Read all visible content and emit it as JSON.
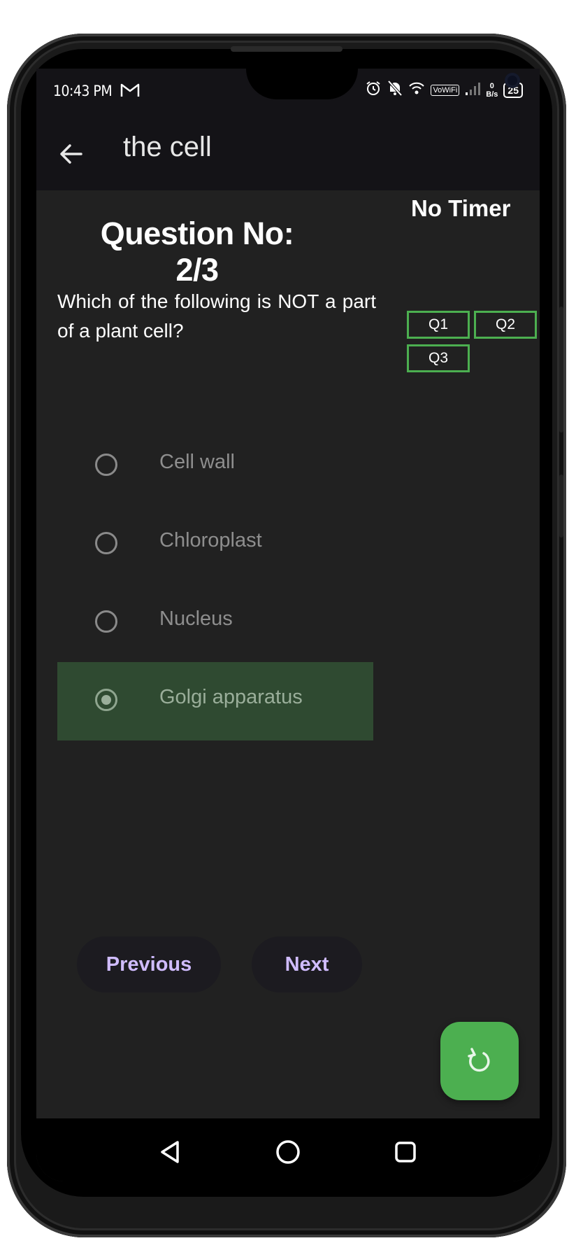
{
  "status_bar": {
    "time": "10:43 PM",
    "wifi_label": "VoWiFi",
    "speed_value": "0",
    "speed_unit": "B/s",
    "battery": "25"
  },
  "app_bar": {
    "title": "the cell"
  },
  "quiz": {
    "question_label": "Question No: 2/3",
    "question_text": "Which of the following is NOT a part of a plant cell?",
    "timer_label": "No Timer",
    "question_nav": [
      "Q1",
      "Q2",
      "Q3"
    ],
    "options": [
      {
        "label": "Cell wall",
        "selected": false
      },
      {
        "label": "Chloroplast",
        "selected": false
      },
      {
        "label": "Nucleus",
        "selected": false
      },
      {
        "label": "Golgi apparatus",
        "selected": true
      }
    ],
    "previous_label": "Previous",
    "next_label": "Next"
  },
  "colors": {
    "accent": "#4caf50",
    "selected_bg": "#2f4a31",
    "button_text": "#d0bcff",
    "background": "#212121"
  },
  "icons": {
    "back": "arrow-left-icon",
    "fab": "refresh-icon",
    "nav_back": "triangle-back-icon",
    "nav_home": "circle-home-icon",
    "nav_recents": "square-recents-icon"
  }
}
